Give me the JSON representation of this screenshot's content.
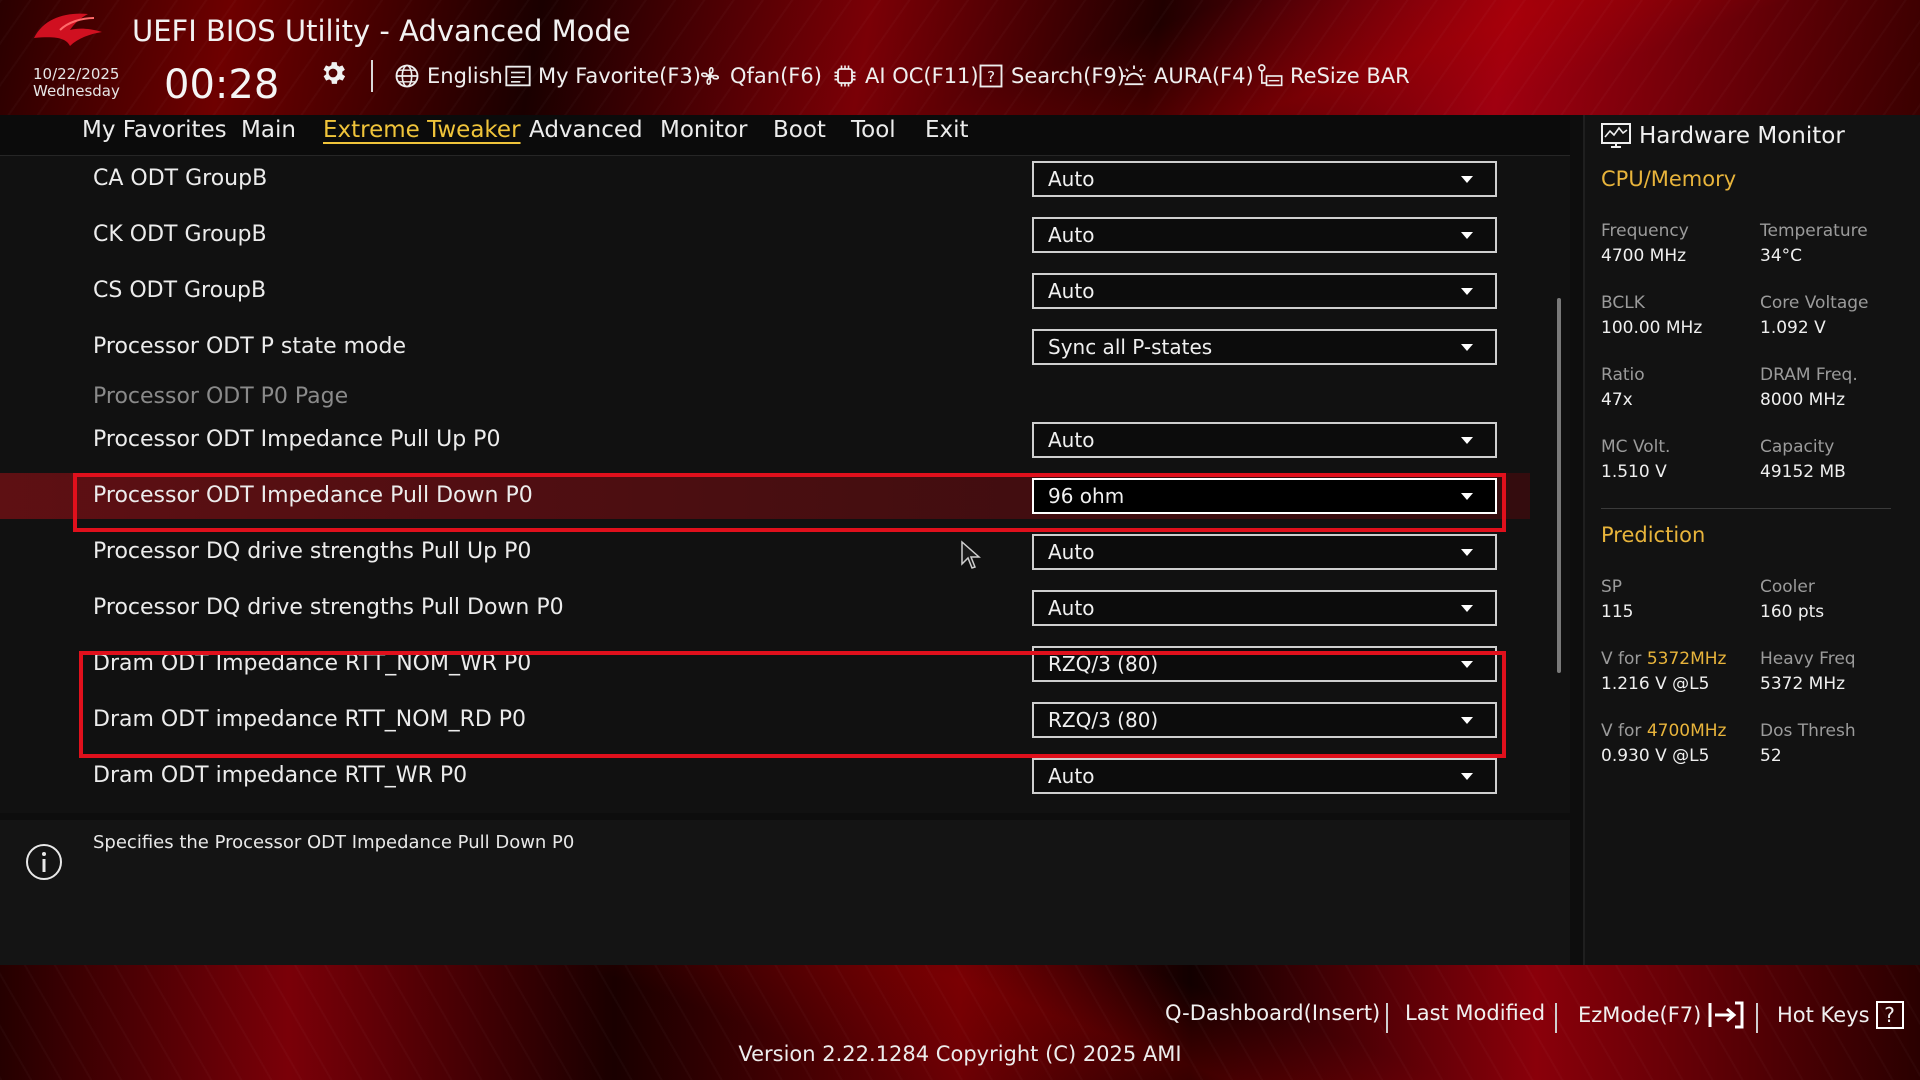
{
  "header": {
    "title": "UEFI BIOS Utility - Advanced Mode",
    "date": "10/22/2025",
    "weekday": "Wednesday",
    "time": "00:28",
    "toolbar": {
      "language": "English",
      "favorite": "My Favorite(F3)",
      "qfan": "Qfan(F6)",
      "aioc": "AI OC(F11)",
      "search": "Search(F9)",
      "aura": "AURA(F4)",
      "resizebar": "ReSize BAR"
    }
  },
  "menu": {
    "tabs": [
      "My Favorites",
      "Main",
      "Extreme Tweaker",
      "Advanced",
      "Monitor",
      "Boot",
      "Tool",
      "Exit"
    ],
    "active": "Extreme Tweaker"
  },
  "settings": [
    {
      "label": "CA ODT GroupB",
      "value": "Auto"
    },
    {
      "label": "CK ODT GroupB",
      "value": "Auto"
    },
    {
      "label": "CS ODT GroupB",
      "value": "Auto"
    },
    {
      "label": "Processor ODT P state mode",
      "value": "Sync all P-states"
    },
    {
      "label": "Processor ODT P0 Page",
      "value": null
    },
    {
      "label": "Processor ODT Impedance Pull Up P0",
      "value": "Auto"
    },
    {
      "label": "Processor ODT Impedance Pull Down P0",
      "value": "96 ohm"
    },
    {
      "label": "Processor DQ drive strengths Pull Up P0",
      "value": "Auto"
    },
    {
      "label": "Processor DQ drive strengths Pull Down P0",
      "value": "Auto"
    },
    {
      "label": "Dram ODT Impedance RTT_NOM_WR P0",
      "value": "RZQ/3 (80)"
    },
    {
      "label": "Dram ODT impedance RTT_NOM_RD P0",
      "value": "RZQ/3 (80)"
    },
    {
      "label": "Dram ODT impedance RTT_WR P0",
      "value": "Auto"
    }
  ],
  "help": {
    "text": "Specifies the Processor ODT Impedance Pull Down P0"
  },
  "hwmon": {
    "title": "Hardware Monitor",
    "cpu_section": "CPU/Memory",
    "frequency_label": "Frequency",
    "frequency": "4700 MHz",
    "temperature_label": "Temperature",
    "temperature": "34°C",
    "bclk_label": "BCLK",
    "bclk": "100.00 MHz",
    "core_voltage_label": "Core Voltage",
    "core_voltage": "1.092 V",
    "ratio_label": "Ratio",
    "ratio": "47x",
    "dram_freq_label": "DRAM Freq.",
    "dram_freq": "8000 MHz",
    "mc_volt_label": "MC Volt.",
    "mc_volt": "1.510 V",
    "capacity_label": "Capacity",
    "capacity": "49152 MB",
    "prediction_section": "Prediction",
    "sp_label": "SP",
    "sp": "115",
    "cooler_label": "Cooler",
    "cooler": "160 pts",
    "vfor_prefix": "V for",
    "vfor1_freq": "5372MHz",
    "vfor1_value": "1.216 V @L5",
    "heavy_freq_label": "Heavy Freq",
    "heavy_freq": "5372 MHz",
    "vfor2_freq": "4700MHz",
    "vfor2_value": "0.930 V @L5",
    "dos_thresh_label": "Dos Thresh",
    "dos_thresh": "52"
  },
  "footer": {
    "qdashboard": "Q-Dashboard(Insert)",
    "last_modified": "Last Modified",
    "ezmode": "EzMode(F7)",
    "hotkeys": "Hot Keys",
    "hotkeys_glyph": "?",
    "version": "Version 2.22.1284 Copyright (C) 2025 AMI"
  },
  "colors": {
    "accent_yellow": "#e8b43b",
    "highlight_red": "#e0101c",
    "selected_row": "#780f14"
  }
}
